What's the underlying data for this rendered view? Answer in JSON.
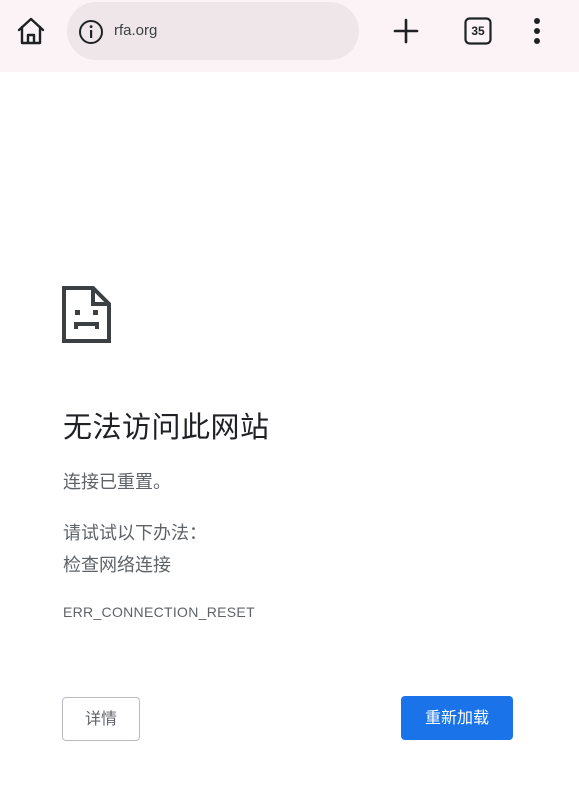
{
  "toolbar": {
    "home_icon": "home-icon",
    "info_icon": "info-icon",
    "url": "rfa.org",
    "new_tab_icon": "plus-icon",
    "tab_count": "35",
    "menu_icon": "more-vert-icon"
  },
  "error": {
    "icon": "sad-page-icon",
    "title": "无法访问此网站",
    "description": "连接已重置。",
    "suggestions_heading": "请试试以下办法：",
    "suggestions": [
      "检查网络连接"
    ],
    "code": "ERR_CONNECTION_RESET"
  },
  "buttons": {
    "details_label": "详情",
    "reload_label": "重新加载"
  },
  "colors": {
    "toolbar_bg": "#fbf3f5",
    "omnibox_bg": "#efe6e9",
    "primary": "#1a73e8"
  }
}
